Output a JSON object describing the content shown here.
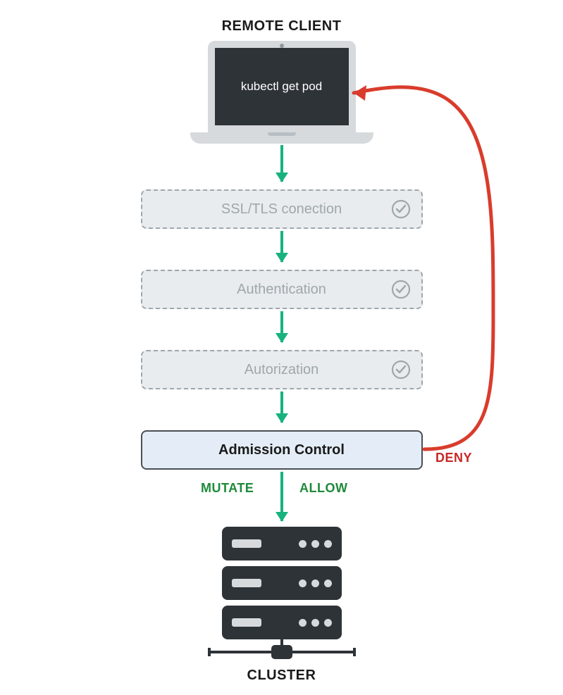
{
  "titles": {
    "top": "REMOTE CLIENT",
    "bottom": "CLUSTER"
  },
  "client": {
    "command": "kubectl get pod"
  },
  "stages": [
    {
      "label": "SSL/TLS conection",
      "state": "dimmed",
      "has_check": true
    },
    {
      "label": "Authentication",
      "state": "dimmed",
      "has_check": true
    },
    {
      "label": "Autorization",
      "state": "dimmed",
      "has_check": true
    },
    {
      "label": "Admission Control",
      "state": "active",
      "has_check": false
    }
  ],
  "outcomes": {
    "mutate": "MUTATE",
    "allow": "ALLOW",
    "deny": "DENY"
  },
  "colors": {
    "arrow_green": "#18b27d",
    "allow_text": "#1e8a3a",
    "deny_red": "#c62828",
    "dimmed_gray": "#9ea7ad",
    "active_bg": "#e4edf7",
    "dark": "#2e3338"
  },
  "server": {
    "unit_count": 3,
    "leds_per_unit": 3
  },
  "flow_description": "Request flows from remote client through SSL/TLS, Authentication, Authorization (all passed) to Admission Control which can MUTATE/ALLOW into cluster or DENY back to client."
}
